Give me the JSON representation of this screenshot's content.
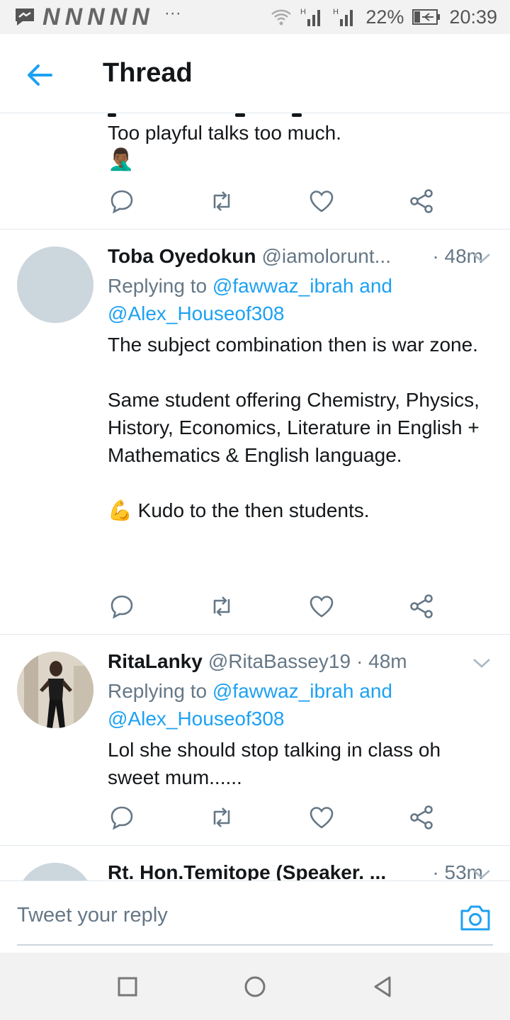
{
  "status_bar": {
    "battery": "22%",
    "time": "20:39",
    "n_icons": [
      "N",
      "N",
      "N",
      "N",
      "N"
    ],
    "more": "···",
    "signal1": "H",
    "signal2": "H"
  },
  "header": {
    "title": "Thread"
  },
  "colors": {
    "accent": "#1da1f2",
    "muted": "#657786",
    "text": "#14171a",
    "divider": "#e1e8ed"
  },
  "top_tweet": {
    "text": "Too playful talks too much.",
    "emoji": "🤦🏾‍♂️"
  },
  "tweets": [
    {
      "name": "Toba Oyedokun",
      "handle": "@iamolorunt...",
      "time": "· 48m",
      "replying_prefix": "Replying to ",
      "replying_to": "@fawwaz_ibrah and",
      "replying_to2": "@Alex_Houseof308",
      "text": "The subject combination then is war zone.\n\nSame student offering Chemistry, Physics, History, Economics, Literature in English + Mathematics & English language.\n\n💪 Kudo to the then students."
    },
    {
      "name": "RitaLanky",
      "handle": "@RitaBassey19",
      "time": "· 48m",
      "replying_prefix": "Replying to ",
      "replying_to": "@fawwaz_ibrah and",
      "replying_to2": "@Alex_Houseof308",
      "text": "Lol she should stop talking in class oh sweet mum......"
    },
    {
      "name": "Rt. Hon.Temitope (Speaker. ...",
      "time": "· 53m"
    }
  ],
  "composer": {
    "placeholder": "Tweet your reply"
  }
}
